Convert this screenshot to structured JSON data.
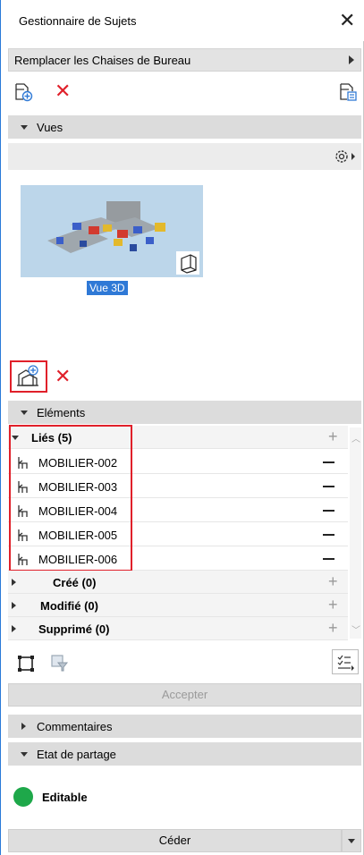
{
  "window": {
    "title": "Gestionnaire de Sujets",
    "close_glyph": "✕"
  },
  "issue": {
    "name": "Remplacer les Chaises de Bureau"
  },
  "views": {
    "section_label": "Vues",
    "items": [
      {
        "label": "Vue 3D"
      }
    ]
  },
  "elements": {
    "section_label": "Eléments",
    "groups": [
      {
        "label": "Liés (5)",
        "expanded": true,
        "items": [
          "MOBILIER-002",
          "MOBILIER-003",
          "MOBILIER-004",
          "MOBILIER-005",
          "MOBILIER-006"
        ]
      },
      {
        "label": "Créé (0)",
        "expanded": false
      },
      {
        "label": "Modifié (0)",
        "expanded": false
      },
      {
        "label": "Supprimé (0)",
        "expanded": false
      }
    ],
    "accept_label": "Accepter"
  },
  "comments": {
    "section_label": "Commentaires"
  },
  "sharing": {
    "section_label": "Etat de partage",
    "status": "Editable",
    "status_color": "#1ea84a",
    "release_label": "Céder"
  },
  "colors": {
    "accent": "#2f79d6",
    "delete": "#e0202a",
    "highlight_box": "#e0202a"
  },
  "icons": [
    "new-issue-icon",
    "delete-icon",
    "issue-list-icon",
    "settings-gear-icon",
    "add-view-icon",
    "model-3d-icon",
    "chair-icon",
    "select-rect-icon",
    "filter-elements-icon",
    "list-options-icon"
  ]
}
